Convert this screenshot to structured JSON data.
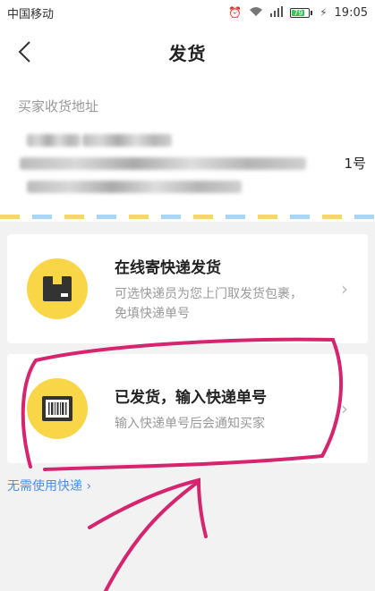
{
  "status_bar": {
    "carrier": "中国移动",
    "time": "19:05",
    "battery": "79"
  },
  "nav": {
    "title": "发货"
  },
  "address": {
    "label": "买家收货地址",
    "visible_suffix": "1号"
  },
  "options": [
    {
      "title": "在线寄快递发货",
      "desc1": "可选快递员为您上门取发货包裹，",
      "desc2": "免填快递单号"
    },
    {
      "title": "已发货，输入快递单号",
      "desc1": "输入快递单号后会通知买家"
    }
  ],
  "no_express_link": "无需使用快递",
  "colors": {
    "accent_yellow": "#f9d648",
    "link_blue": "#4a90e2",
    "annotation_magenta": "#d6246e"
  }
}
